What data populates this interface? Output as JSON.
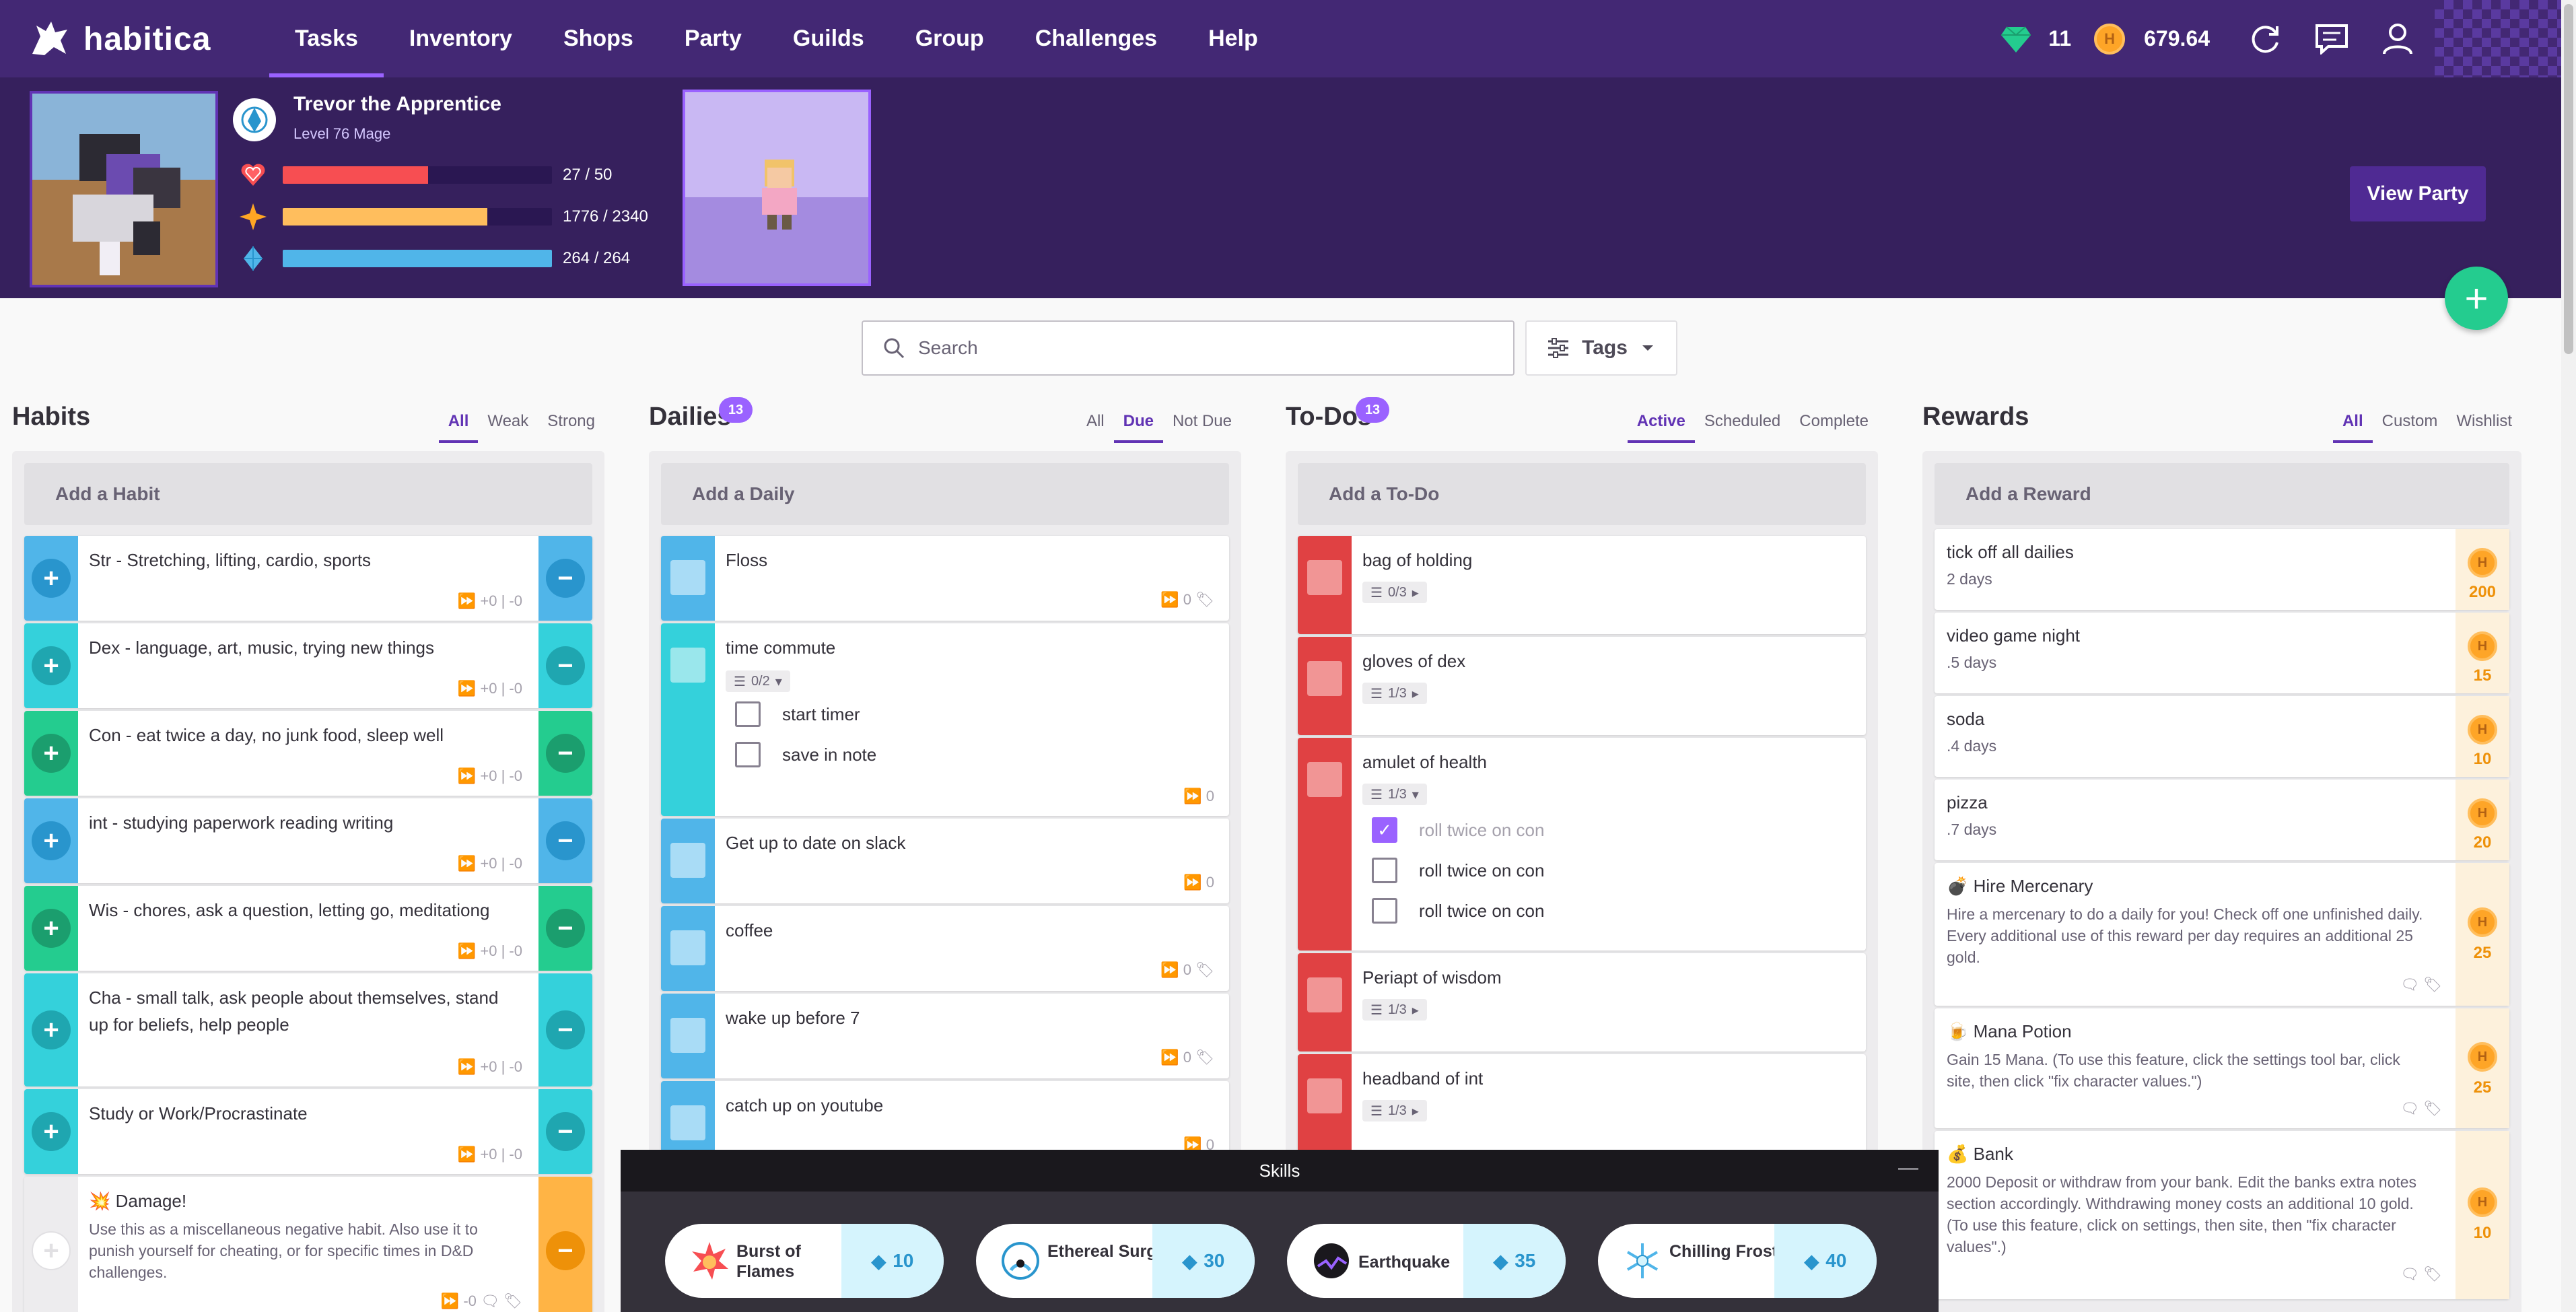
{
  "app": {
    "name": "habitica"
  },
  "nav": {
    "links": [
      "Tasks",
      "Inventory",
      "Shops",
      "Party",
      "Guilds",
      "Group",
      "Challenges",
      "Help"
    ],
    "gems": "11",
    "gold": "679.64"
  },
  "user": {
    "name": "Trevor the Apprentice",
    "level": "Level 76 Mage",
    "health": {
      "text": "27 / 50",
      "fraction": 0.54
    },
    "experience": {
      "text": "1776 / 2340",
      "fraction": 0.759
    },
    "mana": {
      "text": "264 / 264",
      "fraction": 1.0
    }
  },
  "header": {
    "view_party": "View Party"
  },
  "search": {
    "placeholder": "Search"
  },
  "tags": {
    "label": "Tags"
  },
  "habits": {
    "title": "Habits",
    "filters": [
      "All",
      "Weak",
      "Strong"
    ],
    "add": "Add a Habit",
    "items": [
      {
        "title": "Str - Stretching, lifting, cardio, sports",
        "meta": "+0 | -0"
      },
      {
        "title": "Dex - language, art, music, trying new things",
        "meta": "+0 | -0"
      },
      {
        "title": "Con - eat twice a day, no junk food, sleep well",
        "meta": "+0 | -0"
      },
      {
        "title": "int - studying paperwork reading writing",
        "meta": "+0 | -0"
      },
      {
        "title": "Wis - chores, ask a question, letting go, meditationg",
        "meta": "+0 | -0"
      },
      {
        "title": "Cha - small talk, ask people about themselves, stand up for beliefs, help people",
        "meta": "+0 | -0"
      },
      {
        "title": "Study or Work/Procrastinate",
        "meta": "+0 | -0"
      },
      {
        "title": "Damage!",
        "desc": "Use this as a miscellaneous negative habit. Also use it to punish yourself for cheating, or for specific times in D&D challenges.",
        "meta": "-0"
      }
    ]
  },
  "dailies": {
    "title": "Dailies",
    "badge": "13",
    "filters": [
      "All",
      "Due",
      "Not Due"
    ],
    "add": "Add a Daily",
    "items": [
      {
        "title": "Floss",
        "meta": "0"
      },
      {
        "title": "time commute",
        "checklist": "0/2",
        "sub": [
          "start timer",
          "save in note"
        ],
        "meta": "0"
      },
      {
        "title": "Get up to date on slack",
        "meta": "0"
      },
      {
        "title": "coffee",
        "meta": "0"
      },
      {
        "title": "wake up before 7",
        "meta": "0"
      },
      {
        "title": "catch up on youtube",
        "meta": "0"
      }
    ]
  },
  "todos": {
    "title": "To-Dos",
    "badge": "13",
    "filters": [
      "Active",
      "Scheduled",
      "Complete"
    ],
    "add": "Add a To-Do",
    "items": [
      {
        "title": "bag of holding",
        "checklist": "0/3"
      },
      {
        "title": "gloves of dex",
        "checklist": "1/3"
      },
      {
        "title": "amulet of health",
        "checklist": "1/3",
        "sub": [
          "roll twice on con",
          "roll twice on con",
          "roll twice on con"
        ]
      },
      {
        "title": "Periapt of wisdom",
        "checklist": "1/3"
      },
      {
        "title": "headband of int",
        "checklist": "1/3"
      }
    ]
  },
  "rewards": {
    "title": "Rewards",
    "filters": [
      "All",
      "Custom",
      "Wishlist"
    ],
    "add": "Add a Reward",
    "items": [
      {
        "title": "tick off all dailies",
        "note": "2 days",
        "price": "200"
      },
      {
        "title": "video game night",
        "note": ".5 days",
        "price": "15"
      },
      {
        "title": "soda",
        "note": ".4 days",
        "price": "10"
      },
      {
        "title": "pizza",
        "note": ".7 days",
        "price": "20"
      },
      {
        "title": "Hire Mercenary",
        "note": "Hire a mercenary to do a daily for you! Check off one unfinished daily. Every additional use of this reward per day requires an additional 25 gold.",
        "price": "25"
      },
      {
        "title": "Mana Potion",
        "note": "Gain 15 Mana. (To use this feature, click the settings tool bar, click site, then click \"fix character values.\")",
        "price": "25"
      },
      {
        "title": "Bank",
        "note": "2000 Deposit or withdraw from your bank. Edit the banks extra notes section accordingly. Withdrawing money costs an additional 10 gold. (To use this feature, click on settings, then site, then \"fix character values\".)",
        "price": "10"
      }
    ]
  },
  "skills": {
    "title": "Skills",
    "minimize": "—",
    "items": [
      {
        "name": "Burst of Flames",
        "mana": "10"
      },
      {
        "name": "Ethereal Surge",
        "mana": "30"
      },
      {
        "name": "Earthquake",
        "mana": "35"
      },
      {
        "name": "Chilling Frost",
        "mana": "40"
      }
    ]
  },
  "colors": {
    "nav": "#432874",
    "header": "#36205d",
    "accent": "#9a62ff",
    "health": "#f74e52",
    "experience": "#ffbe5d",
    "mana": "#50b5e9",
    "teal": "#24cc8f"
  }
}
